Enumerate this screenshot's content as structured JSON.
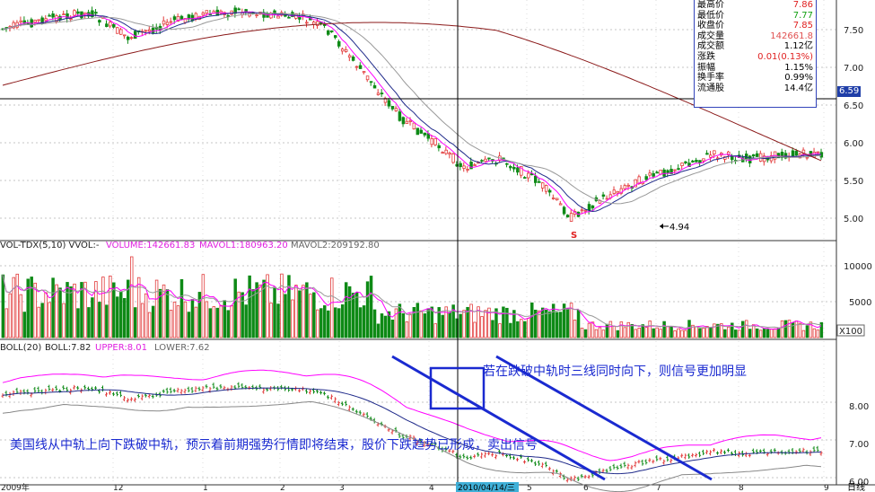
{
  "info_panel": {
    "rows": [
      {
        "label": "最高价",
        "value": "7.86",
        "color": "#e02020"
      },
      {
        "label": "最低价",
        "value": "7.77",
        "color": "#10a010"
      },
      {
        "label": "收盘价",
        "value": "7.85",
        "color": "#e02020"
      },
      {
        "label": "成交量",
        "value": "142661.8",
        "color": "#e05050"
      },
      {
        "label": "成交额",
        "value": "1.12亿",
        "color": "#000000"
      },
      {
        "label": "涨跌",
        "value": "0.01(0.13%)",
        "color": "#e02020"
      },
      {
        "label": "振幅",
        "value": "1.15%",
        "color": "#000000"
      },
      {
        "label": "换手率",
        "value": "0.99%",
        "color": "#000000"
      },
      {
        "label": "流通股",
        "value": "14.4亿",
        "color": "#000000"
      }
    ]
  },
  "crosshair_price": "6.59",
  "main_panel": {
    "y_ticks": [
      "7.50",
      "7.00",
      "6.50",
      "6.00",
      "5.50",
      "5.00"
    ],
    "low_marker": "4.94",
    "s_marker": "S"
  },
  "volume_panel": {
    "title": "VOL-TDX(5,10) VVOL:-",
    "volume": "VOLUME:142661.83",
    "mavol1": "MAVOL1:180963.20",
    "mavol2": "MAVOL2:209192.80",
    "y_ticks": [
      "10000",
      "5000"
    ],
    "unit": "X100"
  },
  "boll_panel": {
    "title": "BOLL(20)",
    "boll": "BOLL:7.82",
    "upper": "UPPER:8.01",
    "lower": "LOWER:7.62",
    "y_ticks": [
      "8.00",
      "7.00",
      "6.00"
    ],
    "annotation_top": "若在跌破中轨时三线同时向下，则信号更加明显",
    "annotation_bottom": "美国线从中轨上向下跌破中轨，预示着前期强势行情即将结束，股价下跌趋势已形成，卖出信号"
  },
  "x_axis": {
    "labels": [
      "2009年",
      "12",
      "1",
      "2",
      "3",
      "4",
      "5",
      "6",
      "7",
      "8",
      "9"
    ],
    "cursor_date": "2010/04/14/三",
    "period": "日线"
  },
  "colors": {
    "up": "#e23b3b",
    "down": "#0e8a16",
    "ma_short": "#ff00ff",
    "ma_mid": "#1f2a8a",
    "ma_long": "#8b1a1a",
    "grid": "#8a8a8a",
    "annotation": "#1a2ad0"
  }
}
